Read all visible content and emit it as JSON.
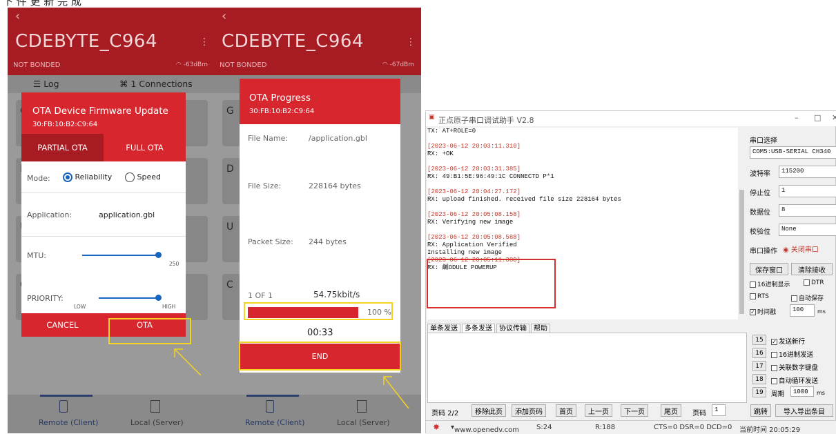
{
  "caption": "下 件 更 新 完 成",
  "colors": {
    "accent_red": "#d7262e",
    "dark_red": "#a71b22",
    "blue": "#1565c0",
    "highlight": "#f4d321"
  },
  "left_phone": {
    "back_icon": "back-arrow-icon",
    "device_name": "CDEBYTE_C964",
    "bond": "NOT BONDED",
    "rssi": "-63dBm",
    "tabs": {
      "log": "Log",
      "connections": "1 Connections"
    },
    "bg_card_letters": [
      "G",
      "D",
      "U",
      "C"
    ],
    "dialog": {
      "title": "OTA Device Firmware Update",
      "address": "30:FB:10:B2:C9:64",
      "tab_partial": "PARTIAL OTA",
      "tab_full": "FULL OTA",
      "mode_label": "Mode:",
      "reliability": "Reliability",
      "speed": "Speed",
      "app_label": "Application:",
      "app_value": "application.gbl",
      "mtu_label": "MTU:",
      "mtu_value": "250",
      "mtu_level": 1.0,
      "priority_label": "PRIORITY:",
      "low": "LOW",
      "high": "HIGH",
      "priority_level": 1.0,
      "cancel": "CANCEL",
      "ota": "OTA"
    },
    "bottom": {
      "remote": "Remote (Client)",
      "local": "Local (Server)"
    }
  },
  "right_phone": {
    "device_name": "CDEBYTE_C964",
    "bond": "NOT BONDED",
    "rssi": "-67dBm",
    "progress": {
      "title": "OTA Progress",
      "address": "30:FB:10:B2:C9:64",
      "file_name_label": "File Name:",
      "file_name": "/application.gbl",
      "file_size_label": "File Size:",
      "file_size": "228164 bytes",
      "packet_label": "Packet Size:",
      "packet_size": "244 bytes",
      "count": "1 OF 1",
      "rate": "54.75kbit/s",
      "percent": "100 %",
      "percent_value": 100,
      "time": "00:33",
      "end": "END"
    },
    "bottom": {
      "remote": "Remote (Client)",
      "local": "Local (Server)"
    }
  },
  "serial": {
    "title": "正点原子串口调试助手 V2.8",
    "log": [
      {
        "text": "TX: AT+ROLE=0",
        "ts": false
      },
      {
        "text": "",
        "ts": false
      },
      {
        "text": "[2023-06-12 20:03:11.310]",
        "ts": true
      },
      {
        "text": "RX: +OK",
        "ts": false
      },
      {
        "text": "",
        "ts": false
      },
      {
        "text": "[2023-06-12 20:03:31.385]",
        "ts": true
      },
      {
        "text": "RX: 49:B1:5E:96:49:1C CONNECTD P*1",
        "ts": false
      },
      {
        "text": "",
        "ts": false
      },
      {
        "text": "[2023-06-12 20:04:27.172]",
        "ts": true
      },
      {
        "text": "RX: upload finished. received file size 228164 bytes",
        "ts": false
      },
      {
        "text": "",
        "ts": false
      },
      {
        "text": "[2023-06-12 20:05:08.158]",
        "ts": true
      },
      {
        "text": "RX: Verifying new image",
        "ts": false
      },
      {
        "text": "",
        "ts": false
      },
      {
        "text": "[2023-06-12 20:05:08.588]",
        "ts": true
      },
      {
        "text": "RX: Application Verified",
        "ts": false
      },
      {
        "text": "Installing new image",
        "ts": false
      },
      {
        "text": "[2023-06-12 20:05:11.380]",
        "ts": true
      },
      {
        "text": "RX: 鹹ODULE POWERUP",
        "ts": false
      }
    ],
    "side": {
      "port_label": "串口选择",
      "port_value": "COM5:USB-SERIAL CH340",
      "baud_label": "波特率",
      "baud": "115200",
      "stop_label": "停止位",
      "stop": "1",
      "data_label": "数据位",
      "data": "8",
      "parity_label": "校验位",
      "parity": "None",
      "op_label": "串口操作",
      "op_btn": "关闭串口",
      "save_btn": "保存窗口",
      "clear_btn": "清除接收",
      "hex_show": "16进制显示",
      "dtr": "DTR",
      "rts": "RTS",
      "autosave": "自动保存",
      "timestamp": "时间戳",
      "ts_val": "100",
      "ms": "ms"
    },
    "tabs": [
      "单条发送",
      "多条发送",
      "协议传输",
      "帮助"
    ],
    "nums": [
      "15",
      "16",
      "17",
      "18",
      "19"
    ],
    "opts": [
      "发送新行",
      "16进制发送",
      "关联数字键盘",
      "自动循环发送"
    ],
    "period_label": "周期",
    "period_val": "1000",
    "period_ms": "ms",
    "nav": {
      "page": "页码 2/2",
      "remove": "移除此页",
      "add": "添加页码",
      "first": "首页",
      "prev": "上一页",
      "next": "下一页",
      "last": "尾页",
      "pgno": "页码",
      "pgval": "1",
      "jump": "跳转",
      "import": "导入导出条目"
    },
    "status": {
      "url": "www.openedv.com",
      "s": "S:24",
      "r": "R:188",
      "lines": "CTS=0 DSR=0 DCD=0",
      "time": "当前时间 20:05:29"
    }
  }
}
